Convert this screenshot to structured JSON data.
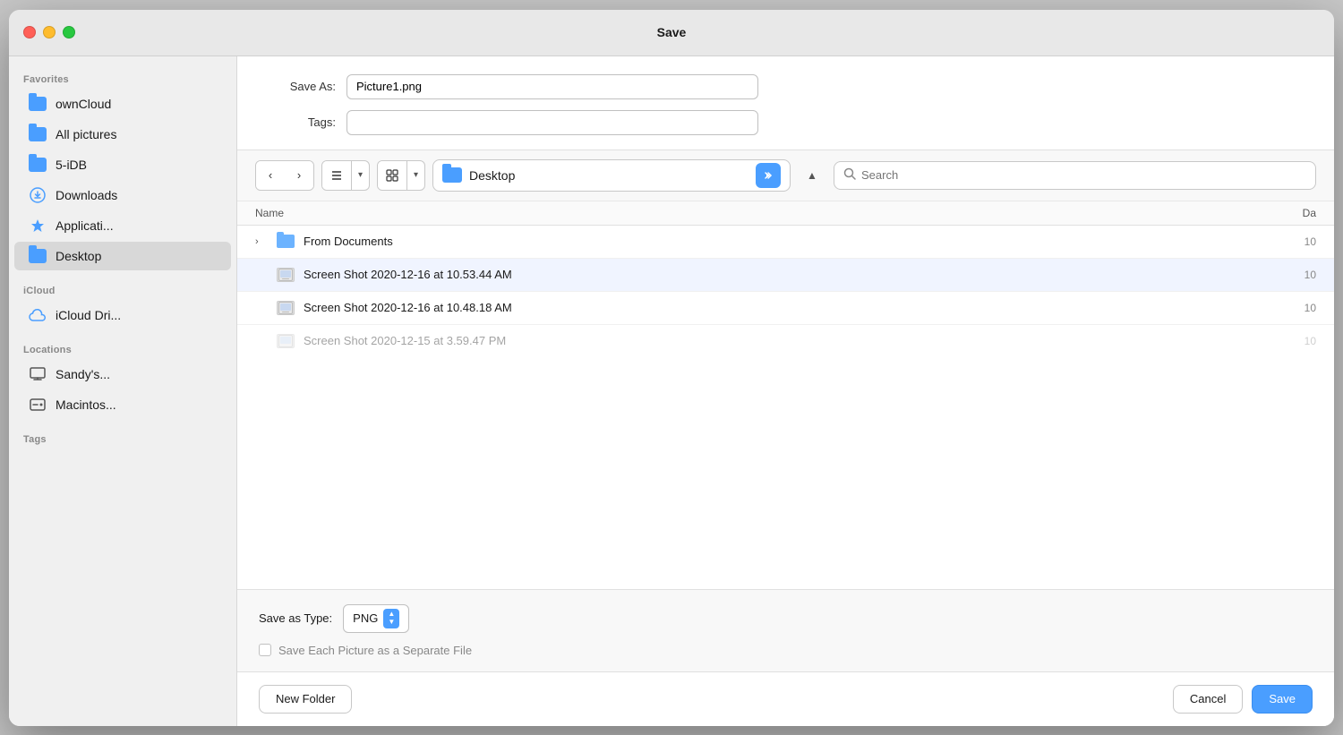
{
  "window": {
    "title": "Save"
  },
  "sidebar": {
    "favorites_label": "Favorites",
    "icloud_label": "iCloud",
    "locations_label": "Locations",
    "tags_label": "Tags",
    "items_favorites": [
      {
        "id": "owncloud",
        "label": "ownCloud",
        "icon": "folder"
      },
      {
        "id": "all-pictures",
        "label": "All pictures",
        "icon": "folder"
      },
      {
        "id": "5idb",
        "label": "5-iDB",
        "icon": "folder"
      },
      {
        "id": "downloads",
        "label": "Downloads",
        "icon": "download"
      },
      {
        "id": "applications",
        "label": "Applicati...",
        "icon": "app"
      },
      {
        "id": "desktop",
        "label": "Desktop",
        "icon": "desktop-folder",
        "active": true
      }
    ],
    "items_icloud": [
      {
        "id": "icloud-drive",
        "label": "iCloud Dri...",
        "icon": "cloud"
      }
    ],
    "items_locations": [
      {
        "id": "sandys",
        "label": "Sandy's...",
        "icon": "computer"
      },
      {
        "id": "macintosh",
        "label": "Macintos...",
        "icon": "harddrive"
      }
    ]
  },
  "toolbar": {
    "back_label": "‹",
    "forward_label": "›",
    "list_icon": "≡",
    "grid_icon": "⊞",
    "location_name": "Desktop",
    "search_placeholder": "Search"
  },
  "form": {
    "save_as_label": "Save As:",
    "save_as_value": "Picture1.png",
    "tags_label": "Tags:",
    "tags_value": ""
  },
  "file_list": {
    "column_name": "Name",
    "column_date": "Da",
    "rows": [
      {
        "type": "folder",
        "name": "From Documents",
        "date": "10",
        "has_chevron": true
      },
      {
        "type": "screenshot",
        "name": "Screen Shot 2020-12-16 at 10.53.44 AM",
        "date": "10",
        "has_chevron": false
      },
      {
        "type": "screenshot",
        "name": "Screen Shot 2020-12-16 at 10.48.18 AM",
        "date": "10",
        "has_chevron": false
      },
      {
        "type": "screenshot",
        "name": "Screen Shot 2020-12-15 at 3.59.47 PM",
        "date": "10",
        "has_chevron": false
      }
    ]
  },
  "bottom": {
    "save_type_label": "Save as Type:",
    "save_type_value": "PNG",
    "checkbox_label": "Save Each Picture as a Separate File"
  },
  "footer": {
    "new_folder_label": "New Folder",
    "cancel_label": "Cancel",
    "save_label": "Save"
  }
}
